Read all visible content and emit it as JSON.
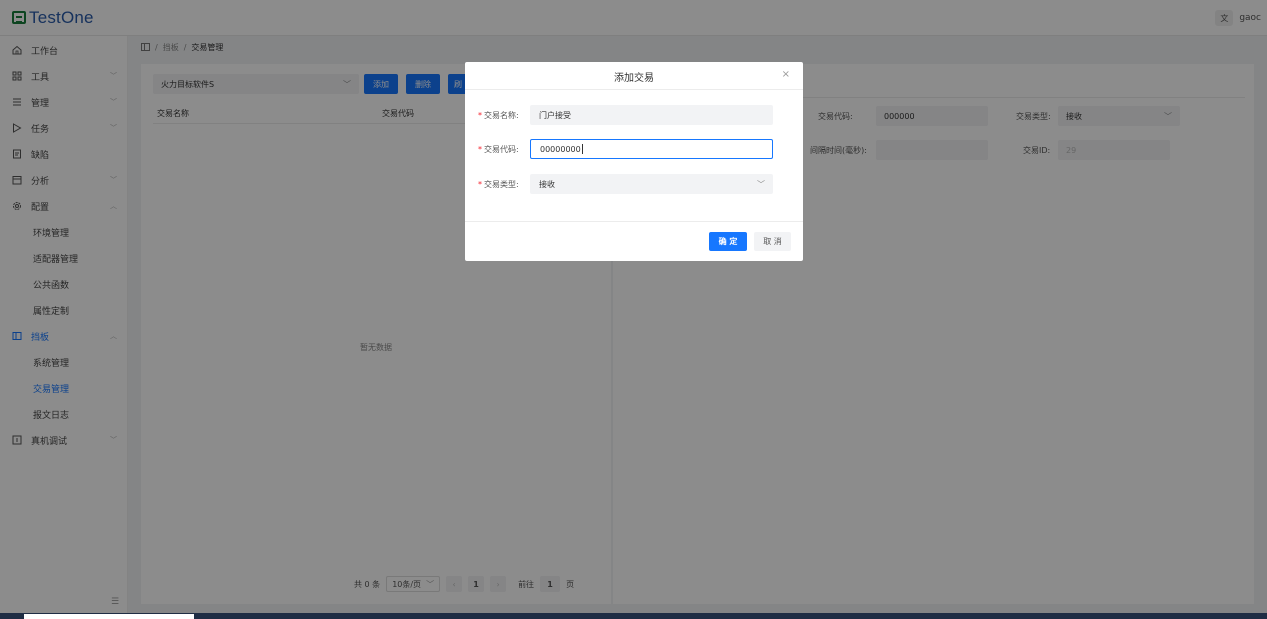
{
  "app": {
    "title": "TestOne"
  },
  "header": {
    "lang_icon": "translate-icon",
    "lang_label": "文",
    "user": "gaoc"
  },
  "sidebar": {
    "items": [
      {
        "label": "工作台",
        "icon": "home-icon"
      },
      {
        "label": "工具",
        "icon": "grid-icon"
      },
      {
        "label": "管理",
        "icon": "list-icon"
      },
      {
        "label": "任务",
        "icon": "play-icon"
      },
      {
        "label": "缺陷",
        "icon": "doc-icon"
      },
      {
        "label": "分析",
        "icon": "calendar-icon"
      },
      {
        "label": "配置",
        "icon": "gear-icon"
      }
    ],
    "config_children": [
      "环境管理",
      "适配器管理",
      "公共函数",
      "属性定制"
    ],
    "board": {
      "label": "挡板",
      "icon": "board-icon"
    },
    "board_children": [
      "系统管理",
      "交易管理",
      "报文日志"
    ],
    "debug": {
      "label": "真机调试",
      "icon": "debug-icon"
    }
  },
  "breadcrumb": {
    "root": "挡板",
    "current": "交易管理",
    "sep": "/"
  },
  "left_panel": {
    "system_select": "火力目标软件S",
    "add_label": "添加",
    "delete_label": "删除",
    "refresh_label": "刷",
    "col_name": "交易名称",
    "col_code": "交易代码",
    "empty": "暂无数据",
    "pager": {
      "total": "共 0 条",
      "page_size": "10条/页",
      "current": "1",
      "goto_label": "前往",
      "goto_value": "1",
      "page_unit": "页"
    }
  },
  "right_panel": {
    "code_label": "交易代码:",
    "code_value": "000000",
    "type_label": "交易类型:",
    "type_value": "接收",
    "interval_label": "间隔时间(毫秒):",
    "interval_value": "",
    "id_label": "交易ID:",
    "id_value": "29"
  },
  "modal": {
    "title": "添加交易",
    "close": "×",
    "name_label": "交易名称:",
    "name_value": "门户接受",
    "code_label": "交易代码:",
    "code_value": "00000000",
    "type_label": "交易类型:",
    "type_value": "接收",
    "ok_label": "确 定",
    "cancel_label": "取 消"
  }
}
